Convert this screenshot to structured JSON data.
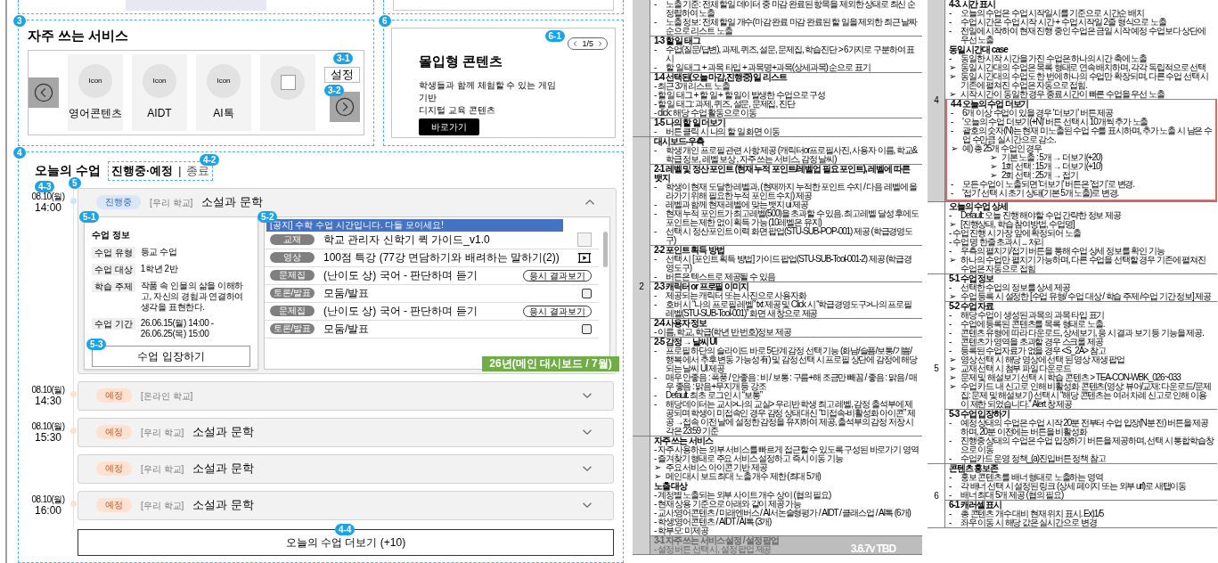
{
  "wireframe": {
    "services": {
      "badge": "3",
      "title": "자주 쓰는 서비스",
      "settings": {
        "badge": "3-1",
        "label": "설정"
      },
      "next_badge": "3-2",
      "items": [
        {
          "kind": "icon",
          "icon_label": "Icon",
          "label": "영어콘텐츠"
        },
        {
          "kind": "icon",
          "icon_label": "Icon",
          "label": "AIDT"
        },
        {
          "kind": "icon",
          "icon_label": "Icon",
          "label": "AI톡"
        },
        {
          "kind": "blank"
        }
      ]
    },
    "promo": {
      "badge": "6",
      "pager_badge": "6-1",
      "pager": "1/5",
      "title": "몰입형 콘텐츠",
      "lines": [
        "학생들과 함께 체험할 수 있는 게임",
        "기반",
        "디지털 교육 콘텐츠"
      ],
      "button": "바로가기"
    },
    "lessons": {
      "badge": "4",
      "title": "오늘의 수업",
      "filter_badge": "4-2",
      "filter_separator": "|",
      "filters": [
        {
          "label": "진행중·예정",
          "selected": true
        },
        {
          "label": "종료",
          "selected": false
        }
      ],
      "time_badge": "4-3",
      "list_badge": "5",
      "items": [
        {
          "date": "08.10(월)",
          "time": "14:00",
          "status": "진행중",
          "kind": "active",
          "school": "[우리 학교]",
          "title": "소설과 문학",
          "expanded": true,
          "detail": {
            "info_badge": "5-1",
            "info_title": "수업 정보",
            "fields": [
              {
                "label": "수업 유형",
                "value": "등교 수업"
              },
              {
                "label": "수업 대상",
                "value": "1학년 2반"
              },
              {
                "label": "학습 주제",
                "value": "작품 속 인물의 삶을 이해하고, 자신의 경험과 연결하여 생각을 표현한다."
              },
              {
                "label": "수업 기간",
                "value": "26.06.15(월) 14:00 - 26.06.25(목) 15:00"
              }
            ],
            "enter_badge": "5-3",
            "enter_button": "수업 입장하기",
            "materials_badge": "5-2",
            "notice": "[공지] 수학 수업 시간입니다. 다들 모이세요!",
            "materials": [
              {
                "tag": "교재",
                "title": "학교 관리자 신학기 퀵 가이드_v1.0",
                "kind": "download"
              },
              {
                "tag": "영상",
                "title": "100점 특강 (77강 면담하기와 배려하는 말하기(2))",
                "kind": "video"
              },
              {
                "tag": "문제집",
                "title": "(난이도 상) 국어 - 판단하며 듣기",
                "kind": "result",
                "action": "응시 결과보기"
              },
              {
                "tag": "토론/발표",
                "title": "모둠/발표",
                "kind": "check",
                "checked": false
              },
              {
                "tag": "문제집",
                "title": "(난이도 상) 국어 - 판단하며 듣기",
                "kind": "result",
                "action": "응시 결과보기"
              },
              {
                "tag": "토론/발표",
                "title": "모둠/발표",
                "kind": "check",
                "checked": false
              }
            ]
          }
        },
        {
          "date": "08.10(월)",
          "time": "14:30",
          "status": "예정",
          "kind": "planned",
          "school": "[온라인 학교]",
          "expanded": false
        },
        {
          "date": "08.10(월)",
          "time": "15:30",
          "status": "예정",
          "kind": "planned",
          "school": "[우리 학교]",
          "title": "소설과 문학",
          "expanded": false
        },
        {
          "status": "예정",
          "kind": "planned",
          "school": "[우리 학교]",
          "title": "소설과 문학",
          "expanded": false
        },
        {
          "date": "08.10(월)",
          "time": "16:00",
          "status": "예정",
          "kind": "planned",
          "school": "[우리 학교]",
          "title": "소설과 문학",
          "expanded": false
        }
      ],
      "more": {
        "badge": "4-4",
        "label": "오늘의 수업 더보기 (+10)"
      }
    },
    "version_label": "26년(메인 대시보드 / 7월)"
  },
  "doc_middle": [
    {
      "shaded": true,
      "cells": [
        {
          "lines": [
            {
              "bullet": "-",
              "text": "노출 기준: 전체 할일 데이터 중 마감 완료된 항목을 제외한 상태로 최신 순 정렬하여 노출"
            },
            {
              "bullet": "-",
              "text": "노출 정보: 전체 할일 개수(마감 완료 마감 완료된 할 일을 제외한 최근 날짜 순으로 리스트 노출"
            }
          ]
        },
        {
          "title": "1-3 할 일 태그",
          "lines": [
            {
              "bullet": "-",
              "text": "수업(질문/답변), 과제, 퀴즈, 설문, 문제집, 학습진단 > 6가지로 구분하여 표시"
            },
            {
              "bullet": "-",
              "text": "할 일 태그 + 과목 타입 + 과목명+과목(상세과목) 순으로 표기"
            }
          ]
        },
        {
          "title": "1-4 선택된(오늘 마감,진행중) 일 리스트",
          "lines": [
            {
              "text": "- 최근 3개 리스트 노출"
            },
            {
              "text": "- 할 일 태그 + 할 일 + 할 일이 발생한 수업으로 구성"
            },
            {
              "text": "- 할 일 태그: 과제, 퀴즈, 설문, 문제집, 진단"
            },
            {
              "text": "- click: 해당 수업 활동으로 이동"
            }
          ]
        },
        {
          "title": "1-5 나의 할 일 더보기",
          "lines": [
            {
              "bullet": "-",
              "text": "버튼 클릭 시 나의 할 일 화면 이동"
            }
          ]
        }
      ]
    },
    {
      "number": "2",
      "shaded": true,
      "cells": [
        {
          "title": "대시보드-우측",
          "lines": [
            {
              "bullet": "-",
              "text": "학생 개인 프로필 관련 사항 제공 (캐릭터or프로필사진, 사용자 이름, 학교&학급 정보, 레벨 보상 , 자주 쓰는 서비스, 감정 날씨)"
            }
          ]
        },
        {
          "title": "2-1 레벨 및 정산 포인트 (현재 누적 포인트/레벨업 필요 포인트), 레벨에 따른 뱃지",
          "lines": [
            {
              "bullet": "-",
              "text": "학생이 현재 도달한 레벨과, (현재까지 누적한 포인트 수치 / 다음 레벨에 올라가기 위해 필요한 누적 포인트 수치) 제공"
            },
            {
              "bullet": "-",
              "text": "레벨과 함께 현재 레벨에 맞는 뱃지 ui 제공"
            },
            {
              "bullet": "-",
              "text": "현재 누적 포인트가 최고레벨(500)을 초과할 수 있음. 최고레벨 달성 후에도 포인트는 제한 없이 획득 가능 (10레벨은 유지)"
            },
            {
              "bullet": "-",
              "text": "선택 시 정산포인트 이력 화면 팝업(STU-SUB-POP-001) 제공 (학급경영도구)"
            }
          ]
        },
        {
          "title": "2-2 포인트 획득 방법",
          "lines": [
            {
              "bullet": "-",
              "text": "선택 시 [포인트 획득 방법] 가이드 팝업(STU-SUB-Tool-001-2) 제공 (학급경영도구)"
            },
            {
              "bullet": "-",
              "text": "버튼은 텍스트로 제공될 수 있음"
            }
          ]
        },
        {
          "title": "2-3 캐릭터 or 프로필 이미지",
          "lines": [
            {
              "bullet": "-",
              "text": "제공되는 캐릭터 또는 사진으로 사용자화"
            },
            {
              "bullet": "-",
              "text": "호버 시 “나의 프로필 레벨” txt 제공 및 Click 시 “학급경영도구>나의 프로필 레벨(STU-SUB-Tool-001)” 화면 새 창으로 제공"
            }
          ]
        },
        {
          "title": "2-4 사용자 정보",
          "lines": [
            {
              "text": "- 이름, 학교, 학급(학년 반 번호)정보 제공"
            }
          ]
        },
        {
          "title": "2-5 감정 → 날씨 UI",
          "lines": [
            {
              "bullet": "-",
              "text": "프로필 하단의 슬라이드 바로 5단계 감정 선택 기능 (화남/슬픔/보통/기쁨/행복 에서 추후 변동 가능성 有) 및 감정 선택 시 프로필 상단에 감정에 해당되는 날씨 UI 제공"
            },
            {
              "bullet": "-",
              "text": "매우 안좋음 : 폭풍 / 안좋음 : 비 / 보통 : 구름+해 조금만 빼꼼 / 좋음 : 맑음 / 매우 좋음 : 맑음+무지개 등 강조"
            },
            {
              "bullet": "-",
              "text": "Default. 최초 로그인 시 “보통”"
            },
            {
              "bullet": "-",
              "text": "해당 데이터는 교사>나의 교실> 우리반 학생 최고 레벨, 감정 출석부에 제공되며 학생이 미접속인 경우 감정 상태 대신 “미접속-비활성화 아이콘” 제공 →접속 이전 날에 설정한 감정을 유지하여 제공, 출석부의 감정 저장 시각은 23:59 기준"
            }
          ]
        }
      ]
    },
    {
      "shaded": true,
      "cells": [
        {
          "title": "자주 쓰는 서비스",
          "lines": [
            {
              "text": "- 자주 사용하는 외부 서비스를 빠르게 접근할 수 있도록 구성된 바로가기 영역"
            },
            {
              "text": "- 즐겨찾기 형태로 주요 서비스 설정하고 즉시 이동 기능"
            },
            {
              "bullet": "➢",
              "text": "주요 서비스 아이콘 기반 제공"
            },
            {
              "bullet": "➢",
              "text": "메인 대시 보드 최대 노출 개수 제한 (최대 5개)"
            },
            {
              "kind": "heading",
              "text": "노출 대상"
            },
            {
              "text": "- 계정별 노출되는 외부 사이트 개수 상이 (협의 필요)"
            },
            {
              "text": "- 현재 상용 기준으로 아래와 같이 제공 가능"
            },
            {
              "text": "- 교사:영어콘텐츠 / 미래엔버스 / AI서논술형평가 / AIDT / 클래스업 / AI톡 (6개)"
            },
            {
              "text": "- 학생:영어콘텐츠 / AIDT / AI톡 (3개)"
            },
            {
              "text": "- 학부모: 미제공"
            }
          ]
        },
        {
          "title": "3-1 자주 쓰는 서비스 설정 / 설정 팝업",
          "shaded": true,
          "stamp": "3.6.7v TBD",
          "lines": [
            {
              "text": "- 설정 버튼 선택 시, 설정 팝업 제공"
            }
          ]
        }
      ]
    }
  ],
  "doc_right": [
    {
      "number": "4",
      "shaded": true,
      "cells": [
        {
          "title": "4-3. 시간 표시",
          "lines": [
            {
              "bullet": "-",
              "text": "오늘의 수업은 수업 시작일시를 기준으로 시간순 배치"
            },
            {
              "bullet": "-",
              "text": "수업 시간은 수업 시작 시간 + 수업 시작일 2줄 형식으로 노출"
            },
            {
              "bullet": "-",
              "text": "전일에 시작하여 현재 진행 중인 수업은 금일 시작 예정 수업보다 상단에 우선 노출"
            },
            {
              "kind": "heading",
              "text": "동일 시간대 case"
            },
            {
              "bullet": "-",
              "text": "동일한 시작 시간을 가진 수업은 하나의 시간 축에 노출"
            },
            {
              "bullet": "➢",
              "text": "동일 시간대의 수업은 목록 형태로 연속 배치하며, 각각 독립적으로 선택"
            },
            {
              "bullet": "➢",
              "text": "동일 시간대의 수업도 한 번에 하나의 수업만 확장되며, 다른 수업 선택 시 기존에 펼쳐진 수업은 자동으로 접힘."
            },
            {
              "bullet": "➢",
              "text": "시작 시간이 동일한 경우 종료 시간이 빠른 수업을 우선 노출"
            }
          ]
        },
        {
          "title": "4-4 오늘의 수업 더보기",
          "highlighted": true,
          "lines": [
            {
              "bullet": "-",
              "text": "6개 이상 수업이 있을 경우 '더보기' 버튼 제공"
            },
            {
              "bullet": "-",
              "text": "'오늘의 수업 더보기(+N)' 버튼 선택 시 10개씩 추가 노출"
            },
            {
              "bullet": "-",
              "text": "괄호의 숫자(N)는 현재 미노출된 수업 수를 표시하며, 추가 노출 시 남은 수업 수만큼 실시간으로 감소."
            },
            {
              "bullet": "➢",
              "text": "예) 총 25개 수업인 경우"
            },
            {
              "kind": "sub",
              "bullet": "➢",
              "text": "기본 노출 : 5개 → 더보기(+20)"
            },
            {
              "kind": "sub",
              "bullet": "➢",
              "text": "1회 선택 : 15개 → 더보기(+10)"
            },
            {
              "kind": "sub",
              "bullet": "➢",
              "text": "2회 선택 : 25개 → 접기"
            },
            {
              "bullet": "-",
              "text": "모든 수업이 노출되면 '더보기' 버튼은 '접기'로 변경."
            },
            {
              "bullet": "-",
              "text": "'접기' 선택 시 초기 상태(기본 5개 노출)로 변경."
            }
          ]
        }
      ]
    },
    {
      "cells": [
        {
          "title": "오늘의 수업 상세",
          "lines": [
            {
              "bullet": "-",
              "text": "Default: 오늘 진행 해야할 수업 간략한 정보 제공"
            },
            {
              "bullet": "➢",
              "text": "[진행상태, 학습 참여방법, 수업명]"
            },
            {
              "text": "- 수업 진행 시 가장 앞에 확정되어 노출"
            },
            {
              "text": "- 수업 명 한줄 초과시 ... 처리"
            },
            {
              "bullet": "-",
              "text": "우측의 펼치기/접기 버튼을 통해 수업 상세 정보를 확인 기능"
            },
            {
              "bullet": "➢",
              "text": "하나의 수업만 펼치기 가능하며, 다른 수업을 선택할 경우 기존에 펼쳐진 수업은 자동으로 접힘"
            }
          ]
        }
      ]
    },
    {
      "number": "5",
      "shaded": false,
      "cells": [
        {
          "title": "5-1 수업 정보",
          "lines": [
            {
              "bullet": "-",
              "text": "선택한 수업의 정보를 상세 제공"
            },
            {
              "bullet": "➢",
              "text": "수업 등록 시 설정한 [수업 유형/ 수업 대상 / 학습 주제 /수업 기간 정보] 제공"
            }
          ]
        },
        {
          "title": "5-2 수업 자료",
          "lines": [
            {
              "bullet": "-",
              "text": "해당 수업이 생성된 과목의 과목 타입 표기"
            },
            {
              "bullet": "-",
              "text": "수업에 등록된 콘텐츠를 목록 형태로 노출."
            },
            {
              "bullet": "-",
              "text": "콘텐츠 유형에 따라 다운로드, 상세보기, 응 시 결과 보기 등 기능을 제공."
            },
            {
              "bullet": "-",
              "text": "콘텐츠가 영역을 초과할 경우 스크롤 제공"
            },
            {
              "bullet": "-",
              "text": "등록된 수업자료가 없을 경우 <S_2A> 참고"
            },
            {
              "bullet": "➢",
              "text": "영상 선택 시 해당 영상에 선택 된 영상 재생 팝업"
            },
            {
              "bullet": "➢",
              "text": "교재 선택 시 첨부 파일 다운로드"
            },
            {
              "bullet": "➢",
              "text": "문제 및 해설보기 선택 시 학습 콘텐츠 > TEA-CON-WBK_026~033"
            },
            {
              "bullet": "➢",
              "text": "수업 카드 내 신고로 인해 비활성화 콘텐츠(영상: 뷰어/교재: 다운로드/문제집: 문제 및 해설보기) 선택 시 “해당 콘텐츠는 여러 차례 신고로 인해 이용이 제한 되었습니다.” Alert 창 제공"
            }
          ]
        },
        {
          "title": "5-3 수업 입장하기",
          "lines": [
            {
              "bullet": "-",
              "text": "예정 상태의 수업은 수업 시작 20분 전부터 수업 입장(N분 전) 버튼을 제공하며, 20분 이전에는 버튼을 비활성화"
            },
            {
              "bullet": "-",
              "text": "진행중 상태의 수업은 수업 입장하기 버튼을 제공하며, 선택 시 통합학습창으로 이동"
            },
            {
              "bullet": "-",
              "text": "수업카드 운영 정책_(a)진입버튼 정책 참고"
            }
          ]
        }
      ]
    },
    {
      "number": "6",
      "shaded": false,
      "cells": [
        {
          "title": "콘텐츠 홍보존",
          "lines": [
            {
              "bullet": "-",
              "text": "홍보 콘텐츠를 배너 형태로 노출하는 영역"
            },
            {
              "bullet": "-",
              "text": "각 배너 선택 시 설정된 링크 (상세 페이지 또는 외부 url)로 새탭이동"
            },
            {
              "bullet": "-",
              "text": "배너 최대 5개 제공 (협의 필요)"
            }
          ]
        },
        {
          "title": "6-1 캐러셀 표시",
          "lines": [
            {
              "bullet": "-",
              "text": "총 콘텐츠 개수 대비 현재 위치 표시. Ex)1/5"
            },
            {
              "bullet": "-",
              "text": "좌우 이동 시 해당 값은 실시간으로 변경"
            }
          ]
        }
      ]
    }
  ]
}
